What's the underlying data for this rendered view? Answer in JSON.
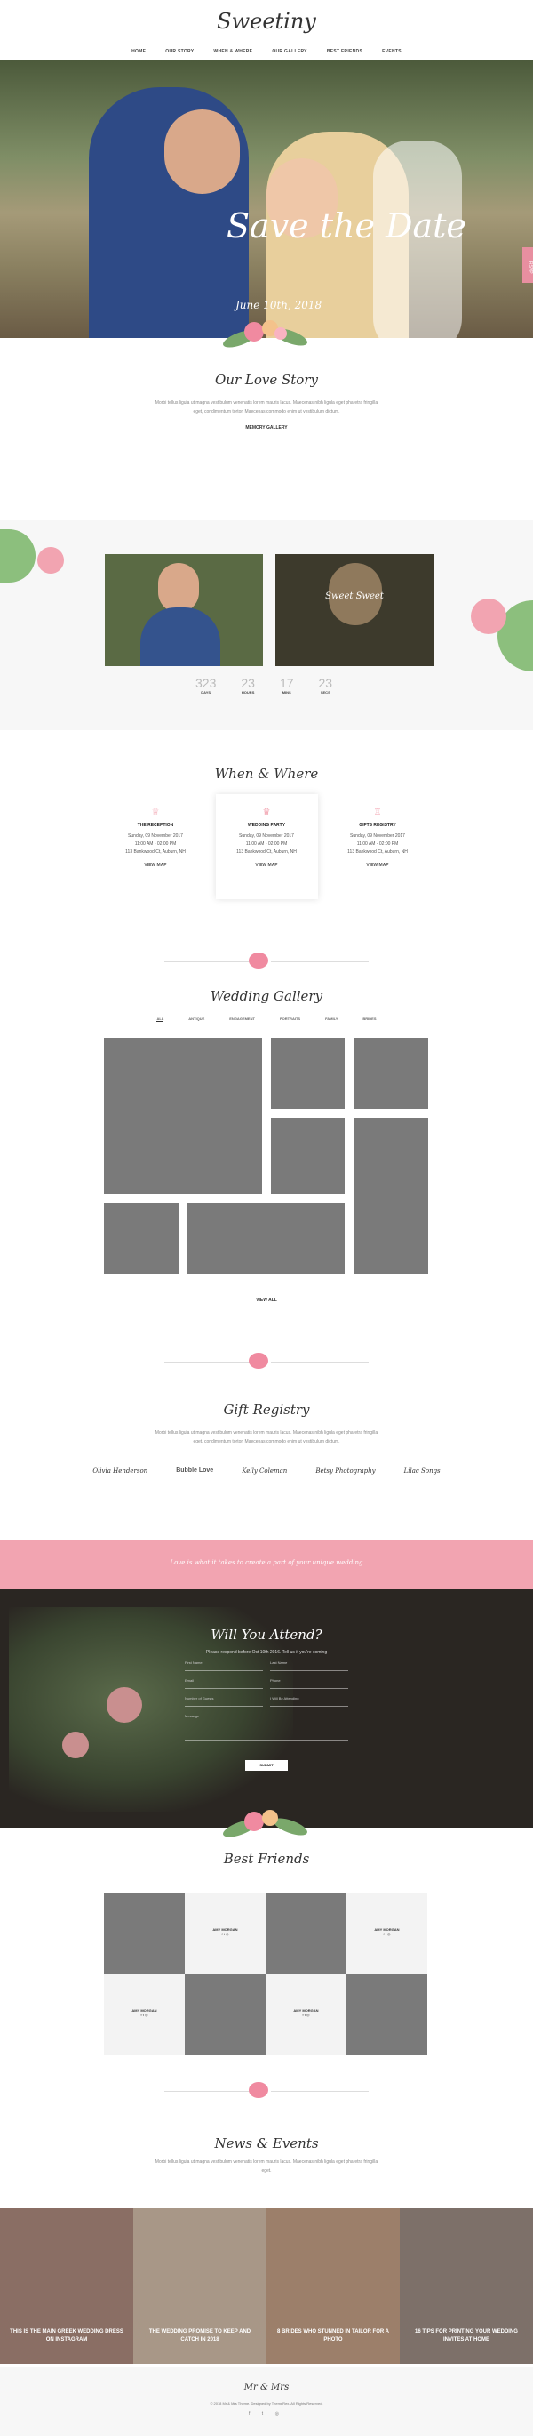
{
  "brand": "Sweetiny",
  "nav": [
    "HOME",
    "OUR STORY",
    "WHEN & WHERE",
    "OUR GALLERY",
    "BEST FRIENDS",
    "EVENTS"
  ],
  "hero": {
    "title": "Save the Date",
    "date": "June 10th, 2018",
    "side_tab": "RSVP"
  },
  "story": {
    "title": "Our Love Story",
    "text": "Morbi tellus ligula ut magna vestibulum venenatis lorem mauris lacus. Maecenas nibh ligula eget pharetra fringilla eget, condimentum tortor. Maecenas commodo enim ut vestibulum dictum.",
    "button": "MEMORY GALLERY"
  },
  "couple": {
    "bride": "Sweet Sweet",
    "countdown": [
      {
        "n": "323",
        "l": "DAYS"
      },
      {
        "n": "23",
        "l": "HOURS"
      },
      {
        "n": "17",
        "l": "MINS"
      },
      {
        "n": "23",
        "l": "SECS"
      }
    ]
  },
  "when": {
    "title": "When & Where",
    "cards": [
      {
        "title": "THE RECEPTION",
        "date": "Sunday, 09 November 2017",
        "time": "11:00 AM - 02:00 PM",
        "addr": "113 Bankwood Ct, Auburn, NH",
        "link": "VIEW MAP"
      },
      {
        "title": "WEDDING PARTY",
        "date": "Sunday, 09 November 2017",
        "time": "11:00 AM - 02:00 PM",
        "addr": "113 Bankwood Ct, Auburn, NH",
        "link": "VIEW MAP"
      },
      {
        "title": "GIFTS REGISTRY",
        "date": "Sunday, 09 November 2017",
        "time": "11:00 AM - 02:00 PM",
        "addr": "113 Bankwood Ct, Auburn, NH",
        "link": "VIEW MAP"
      }
    ]
  },
  "gallery": {
    "title": "Wedding Gallery",
    "tabs": [
      "ALL",
      "ANTIQUE",
      "ENGAGEMENT",
      "PORTRAITS",
      "FAMILY",
      "BRIDES"
    ],
    "button": "VIEW ALL"
  },
  "registry": {
    "title": "Gift Registry",
    "text": "Morbi tellus ligula ut magna vestibulum venenatis lorem mauris lacus. Maecenas nibh ligula eget pharetra fringilla eget, condimentum tortor. Maecenas commodo enim ut vestibulum dictum.",
    "logos": [
      "Olivia Henderson",
      "Bubble Love",
      "Kelly Coleman",
      "Betsy Photography",
      "Lilac Songs"
    ]
  },
  "quote": "Love is what it takes to create a part of your unique wedding",
  "rsvp": {
    "title": "Will You Attend?",
    "sub": "Please respond before Oct 10th 2016. Tell us if you're coming",
    "fields": [
      "First Name",
      "Email",
      "Number of Guests",
      "Message"
    ],
    "field_right": [
      "Last Name",
      "Phone",
      "I Will Be Attending"
    ],
    "submit": "SUBMIT"
  },
  "friends": {
    "title": "Best Friends",
    "name": "AMY MORGAN",
    "social": "f  t  ◎"
  },
  "news": {
    "title": "News & Events",
    "text": "Morbi tellus ligula ut magna vestibulum venenatis lorem mauris lacus. Maecenas nibh ligula eget pharetra fringilla eget.",
    "items": [
      "THIS IS THE MAIN GREEK WEDDING DRESS ON INSTAGRAM",
      "THE WEDDING PROMISE TO KEEP AND CATCH IN 2018",
      "8 BRIDES WHO STUNNED IN TAILOR FOR A PHOTO",
      "16 TIPS FOR PRINTING YOUR WEDDING INVITES AT HOME"
    ]
  },
  "footer": {
    "mark": "Mr & Mrs",
    "copy": "© 2018 Mr & Mrs Theme. Designed by ThemeRex. All Rights Reserved.",
    "social": "f t ◎"
  },
  "colors": {
    "accent": "#f2a4b1",
    "tile": "#7a7a7a"
  }
}
